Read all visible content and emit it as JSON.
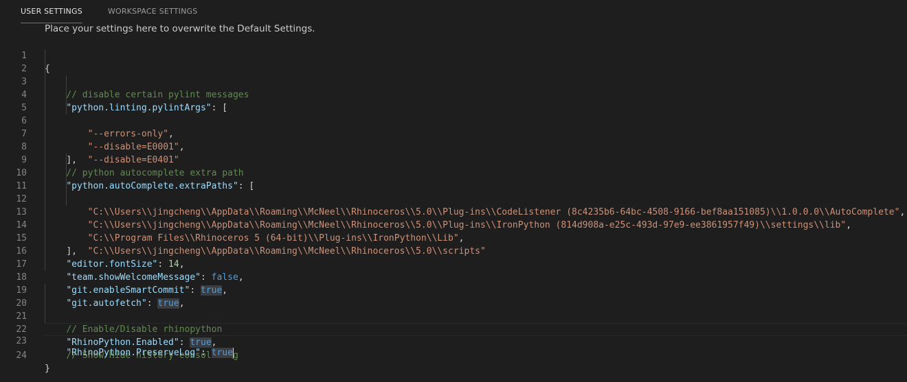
{
  "tabs": {
    "user": "USER SETTINGS",
    "workspace": "WORKSPACE SETTINGS"
  },
  "banner": "Place your settings here to overwrite the Default Settings.",
  "code": {
    "l1_open": "{",
    "l2_comment": "// disable certain pylint messages",
    "l3_key": "\"python.linting.pylintArgs\"",
    "l3_rest": ": [",
    "l4_val": "\"--errors-only\"",
    "l4_rest": ",",
    "l5_val": "\"--disable=E0001\"",
    "l5_rest": ",",
    "l6_val": "\"--disable=E0401\"",
    "l7_close": "],",
    "l8_comment": "// python autocomplete extra path",
    "l9_key": "\"python.autoComplete.extraPaths\"",
    "l9_rest": ": [",
    "l10_val": "\"C:\\\\Users\\\\jingcheng\\\\AppData\\\\Roaming\\\\McNeel\\\\Rhinoceros\\\\5.0\\\\Plug-ins\\\\CodeListener (8c4235b6-64bc-4508-9166-bef8aa151085)\\\\1.0.0.0\\\\AutoComplete\"",
    "l10_rest": ",",
    "l11_val": "\"C:\\\\Users\\\\jingcheng\\\\AppData\\\\Roaming\\\\McNeel\\\\Rhinoceros\\\\5.0\\\\Plug-ins\\\\IronPython (814d908a-e25c-493d-97e9-ee3861957f49)\\\\settings\\\\lib\"",
    "l11_rest": ",",
    "l12_val": "\"C:\\\\Program Files\\\\Rhinoceros 5 (64-bit)\\\\Plug-ins\\\\IronPython\\\\Lib\"",
    "l12_rest": ",",
    "l13_val": "\"C:\\\\Users\\\\jingcheng\\\\AppData\\\\Roaming\\\\McNeel\\\\Rhinoceros\\\\5.0\\\\scripts\"",
    "l14_close": "],",
    "l15_key": "\"editor.fontSize\"",
    "l15_colon": ": ",
    "l15_val": "14",
    "l15_rest": ",",
    "l16_key": "\"team.showWelcomeMessage\"",
    "l16_colon": ": ",
    "l16_val": "false",
    "l16_rest": ",",
    "l17_key": "\"git.enableSmartCommit\"",
    "l17_colon": ": ",
    "l17_val": "true",
    "l17_rest": ",",
    "l18_key": "\"git.autofetch\"",
    "l18_colon": ": ",
    "l18_val": "true",
    "l18_rest": ",",
    "l20_comment": "// Enable/Disable rhinopython",
    "l21_key": "\"RhinoPython.Enabled\"",
    "l21_colon": ": ",
    "l21_val": "true",
    "l21_rest": ",",
    "l22_comment": "// Show/Hide history console log",
    "l23_key": "\"RhinoPython.PreserveLog\"",
    "l23_colon": ": ",
    "l23_val": "true",
    "l24_close": "}"
  },
  "line_numbers": [
    "1",
    "2",
    "3",
    "4",
    "5",
    "6",
    "7",
    "8",
    "9",
    "10",
    "11",
    "12",
    "13",
    "14",
    "15",
    "16",
    "17",
    "18",
    "19",
    "20",
    "21",
    "22",
    "23",
    "24"
  ],
  "colors": {
    "background": "#1e1e1e",
    "string": "#ce9178",
    "key": "#9cdcfe",
    "comment": "#608b4e",
    "number": "#b5cea8",
    "keyword": "#569cd6"
  }
}
